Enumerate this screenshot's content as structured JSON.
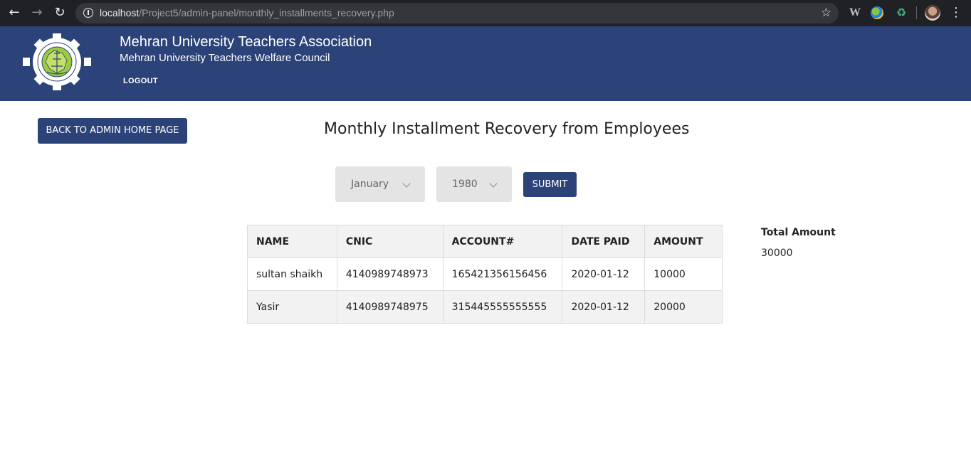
{
  "browser": {
    "url_host": "localhost",
    "url_path": "/Project5/admin-panel/monthly_installments_recovery.php",
    "icons": [
      "back-arrow-icon",
      "forward-arrow-icon",
      "reload-icon",
      "info-icon",
      "bookmark-star-icon",
      "menu-dots-icon"
    ]
  },
  "header": {
    "title": "Mehran University Teachers Association",
    "subtitle": "Mehran University Teachers Welfare Council",
    "logout_label": "LOGOUT",
    "bg_color": "#2c4379"
  },
  "main": {
    "back_button_label": "BACK TO ADMIN HOME PAGE",
    "page_title": "Monthly Installment Recovery from Employees",
    "month_select_value": "January",
    "year_select_value": "1980",
    "submit_label": "SUBMIT",
    "table": {
      "headers": [
        "NAME",
        "CNIC",
        "ACCOUNT#",
        "DATE PAID",
        "AMOUNT"
      ],
      "rows": [
        [
          "sultan shaikh",
          "4140989748973",
          "165421356156456",
          "2020-01-12",
          "10000"
        ],
        [
          "Yasir",
          "4140989748975",
          "315445555555555",
          "2020-01-12",
          "20000"
        ]
      ]
    },
    "total_label": "Total Amount",
    "total_value": "30000"
  }
}
